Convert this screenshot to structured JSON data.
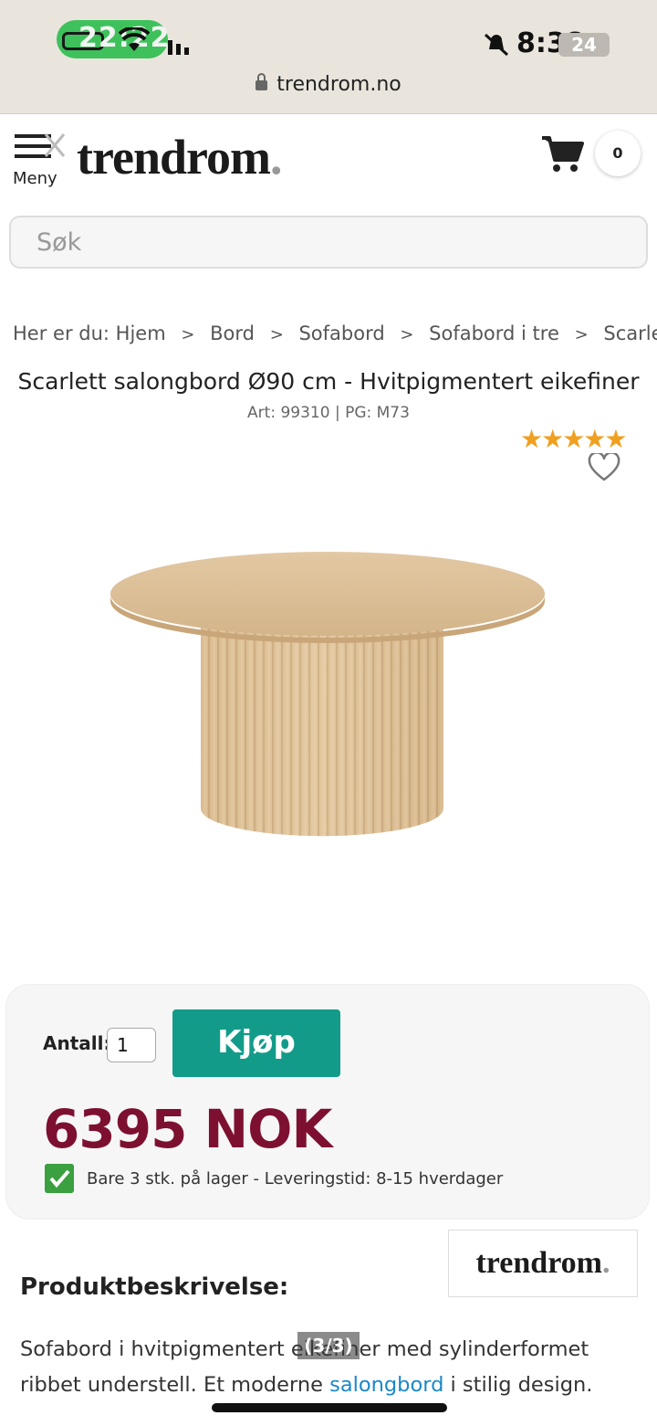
{
  "statusbar": {
    "time": "22:22",
    "right_time": "8:38",
    "battery": "24",
    "url": "trendrom.no"
  },
  "header": {
    "menu_label": "Meny",
    "logo": "trendrom",
    "logo_dot": ".",
    "cart_count": "0"
  },
  "search": {
    "placeholder": "Søk"
  },
  "breadcrumb": {
    "prefix": "Her er du:",
    "items": [
      "Hjem",
      "Bord",
      "Sofabord",
      "Sofabord i tre",
      "Scarlett salongbord"
    ]
  },
  "product": {
    "title": "Scarlett salongbord Ø90 cm - Hvitpigmentert eikefiner",
    "meta": "Art: 99310 | PG: M73",
    "rating": 5,
    "stars": "★★★★★"
  },
  "buybox": {
    "qty_label": "Antall:",
    "qty_value": "1",
    "buy_label": "Kjøp",
    "price": "6395 NOK",
    "stock": "Bare 3 stk. på lager - Leveringstid: 8-15 hverdager"
  },
  "brand": {
    "logo": "trendrom",
    "dot": "."
  },
  "description": {
    "heading": "Produktbeskrivelse:",
    "text_before": "Sofabord i hvitpigmentert eikefiner med sylinderformet ribbet understell. Et moderne ",
    "link": "salongbord",
    "text_after": " i stilig design."
  },
  "page_indicator": "(3/3)",
  "colors": {
    "accent": "#139b8a",
    "price": "#7d1030",
    "link": "#1a88c9",
    "stars": "#f0a020"
  }
}
